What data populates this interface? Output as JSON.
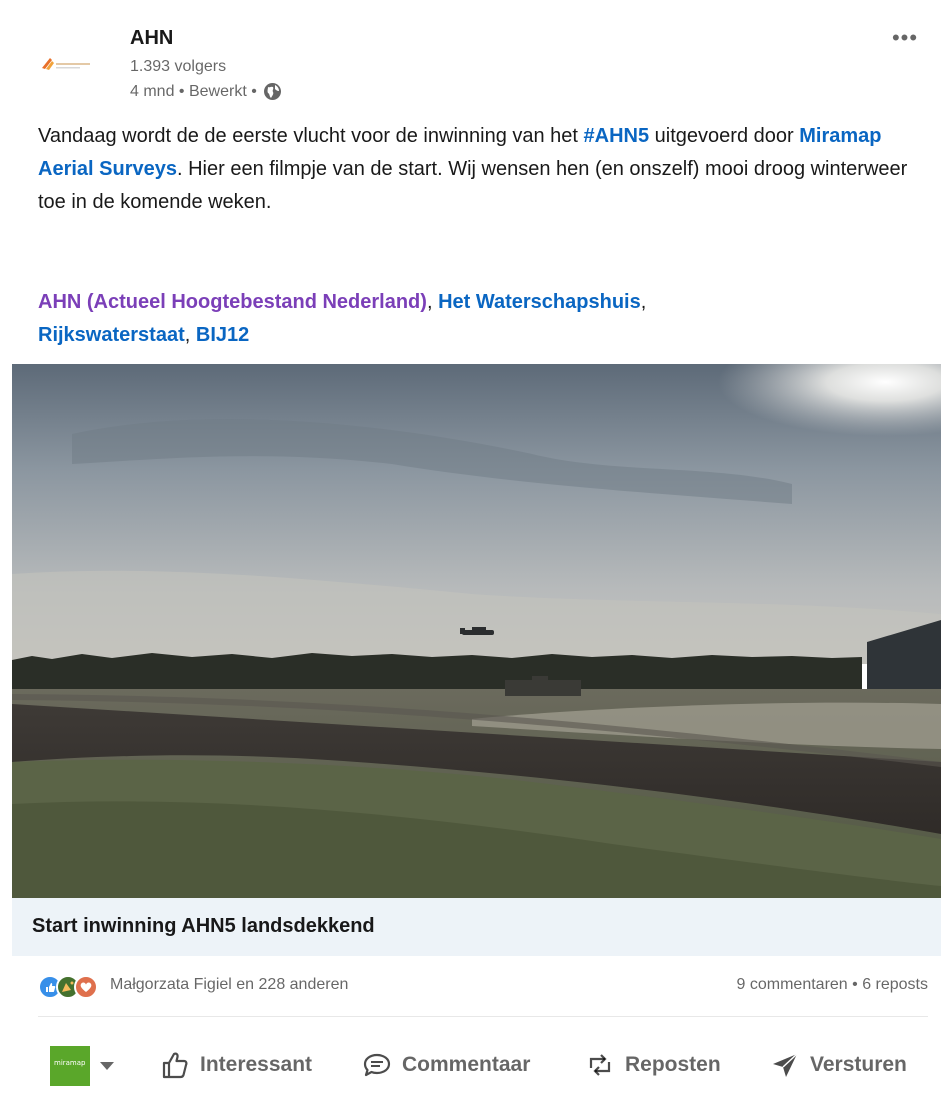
{
  "post": {
    "author": "AHN",
    "followers": "1.393 volgers",
    "meta": "4 mnd • Bewerkt •",
    "more_label": "•••",
    "text": {
      "part1": "Vandaag wordt de de eerste vlucht voor de inwinning van het ",
      "hashtag": "#AHN5",
      "part2": " uitgevoerd door ",
      "org_link": "Miramap Aerial Surveys",
      "part3": ". Hier een filmpje van de start. Wij wensen hen (en onszelf) mooi droog winterweer toe in de komende weken."
    },
    "mentions": {
      "m1": "AHN (Actueel Hoogtebestand Nederland)",
      "sep1": ", ",
      "m2": "Het Waterschapshuis",
      "sep2": ",",
      "m3": "Rijkswaterstaat",
      "sep3": ", ",
      "m4": "BIJ12"
    },
    "video_caption": "Start inwinning AHN5 landsdekkend",
    "reactions_text": "Małgorzata Figiel en 228 anderen",
    "comments_reposts": "9 commentaren • 6 reposts"
  },
  "actions": {
    "actor_thumb": "miramap",
    "like": "Interessant",
    "comment": "Commentaar",
    "repost": "Reposten",
    "send": "Versturen"
  },
  "icons": {
    "globe": "globe-icon",
    "like": "thumbs-up-icon",
    "comment": "speech-bubble-icon",
    "repost": "repost-arrows-icon",
    "send": "paper-plane-icon",
    "reactions": [
      "like-reaction-icon",
      "celebrate-reaction-icon",
      "love-reaction-icon"
    ]
  },
  "colors": {
    "link_blue": "#0a66c2",
    "link_purple": "#7b3fb8",
    "caption_bg": "#edf3f8",
    "actor_green": "#5aa72a"
  }
}
